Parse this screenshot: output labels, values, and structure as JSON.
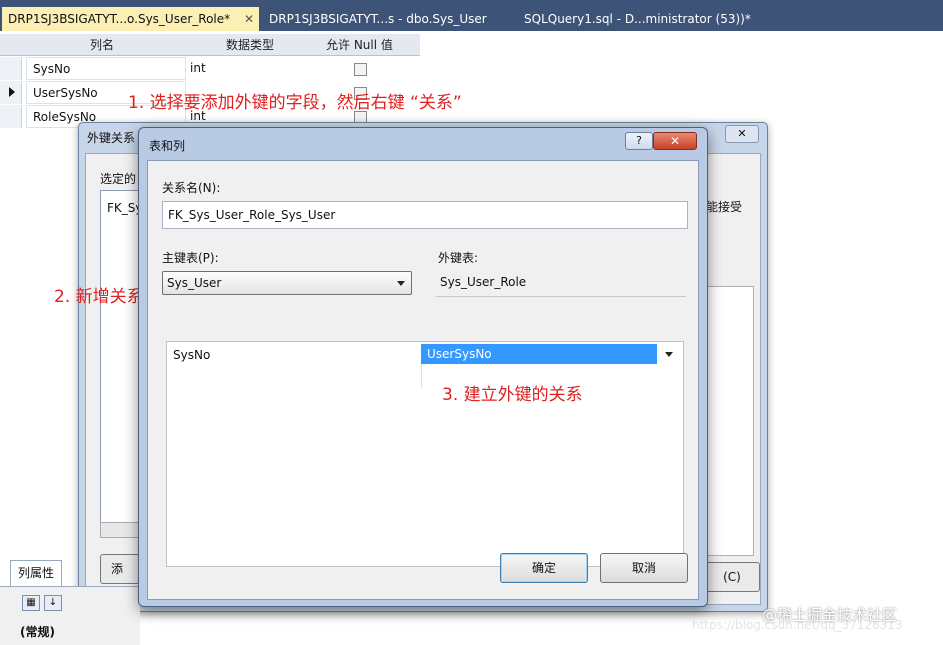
{
  "tabs": [
    {
      "label": "DRP1SJ3BSIGATYT...o.Sys_User_Role*",
      "active": true
    },
    {
      "label": "DRP1SJ3BSIGATYT...s - dbo.Sys_User",
      "active": false
    },
    {
      "label": "SQLQuery1.sql - D...ministrator (53))*",
      "active": false
    }
  ],
  "designer": {
    "headers": {
      "column_name": "列名",
      "data_type": "数据类型",
      "allow_null": "允许 Null 值"
    },
    "rows": [
      {
        "name": "SysNo",
        "type": "int"
      },
      {
        "name": "UserSysNo",
        "type": "",
        "current": true
      },
      {
        "name": "RoleSysNo",
        "type": "int"
      }
    ]
  },
  "annotations": {
    "step1": "1. 选择要添加外键的字段，然后右键 “关系”",
    "step2": "2. 新增关系",
    "step3": "3. 建立外键的关系"
  },
  "fk_dialog": {
    "title": "外键关系",
    "selected_label": "选定的",
    "list_item": "FK_Sy",
    "right_text": "能接受",
    "add_button": "添",
    "close_button": "(C)",
    "close_icon": "✕"
  },
  "props": {
    "tab": "列属性",
    "group": "(常规)"
  },
  "dialog": {
    "title": "表和列",
    "help_icon": "?",
    "close_icon": "✕",
    "relation_name_label": "关系名(N):",
    "relation_name_value": "FK_Sys_User_Role_Sys_User",
    "pk_table_label": "主键表(P):",
    "pk_table_value": "Sys_User",
    "fk_table_label": "外键表:",
    "fk_table_value": "Sys_User_Role",
    "pk_column": "SysNo",
    "fk_column": "UserSysNo",
    "ok_button": "确定",
    "cancel_button": "取消"
  },
  "watermark": {
    "brand": "@稀土掘金技术社区",
    "url": "https://blog.csdn.net/qq_37126313"
  },
  "colors": {
    "annotation": "#e02020",
    "selection": "#3399ff",
    "active_tab": "#fbefb4"
  }
}
